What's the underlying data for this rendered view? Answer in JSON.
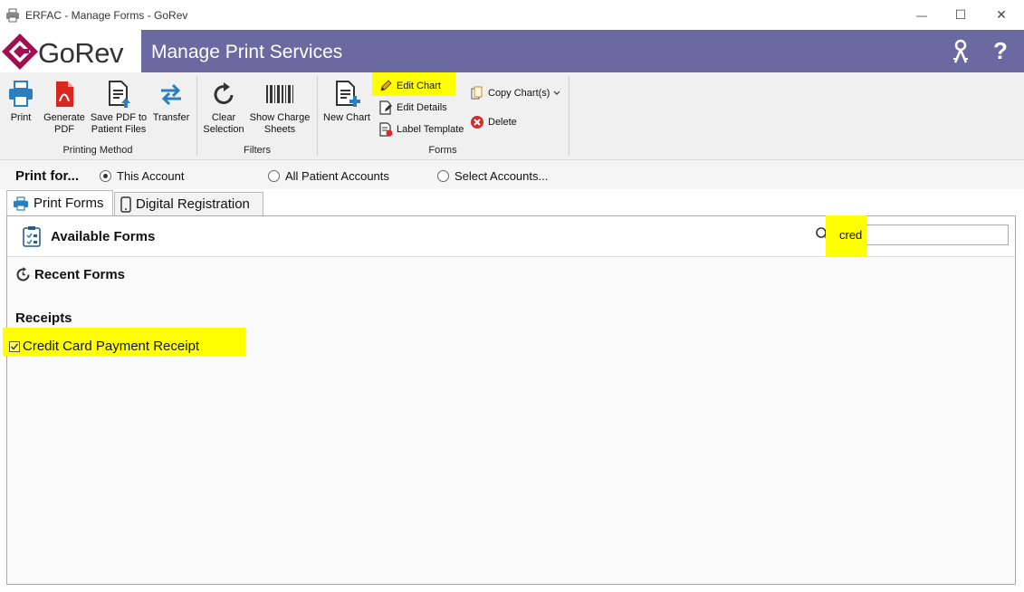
{
  "window": {
    "title": "ERFAC - Manage Forms - GoRev",
    "controls": {
      "minimize": "—",
      "maximize": "☐",
      "close": "✕"
    }
  },
  "header": {
    "logo_text": "GoRev",
    "page_title": "Manage Print Services",
    "keys_icon": "keys-icon",
    "help_label": "?"
  },
  "ribbon": {
    "printing_method": {
      "label": "Printing Method",
      "buttons": [
        {
          "label": "Print"
        },
        {
          "label": "Generate PDF"
        },
        {
          "label": "Save PDF to Patient Files"
        },
        {
          "label": "Transfer"
        }
      ]
    },
    "filters": {
      "label": "Filters",
      "buttons": [
        {
          "label": "Clear Selection"
        },
        {
          "label": "Show Charge Sheets"
        }
      ]
    },
    "forms": {
      "label": "Forms",
      "new_chart": "New Chart",
      "edit_chart": "Edit Chart",
      "edit_details": "Edit Details",
      "label_template": "Label Template",
      "copy_charts": "Copy Chart(s)",
      "delete": "Delete"
    }
  },
  "print_for": {
    "label": "Print for...",
    "options": [
      {
        "label": "This Account",
        "selected": true
      },
      {
        "label": "All Patient Accounts",
        "selected": false
      },
      {
        "label": "Select Accounts...",
        "selected": false
      }
    ]
  },
  "tabs": [
    {
      "label": "Print Forms",
      "active": true
    },
    {
      "label": "Digital Registration",
      "active": false
    }
  ],
  "main": {
    "available_forms": "Available Forms",
    "search_value": "cred",
    "recent_forms": "Recent Forms",
    "section": "Receipts",
    "forms": [
      {
        "label": "Credit Card Payment Receipt",
        "checked": true
      }
    ]
  },
  "colors": {
    "banner": "#6b6aa0",
    "logo_magenta": "#a01050",
    "highlight": "#ffff00",
    "icon_blue": "#2a7fc0",
    "pdf_red": "#d8271f",
    "delete_red": "#d62b2b"
  }
}
